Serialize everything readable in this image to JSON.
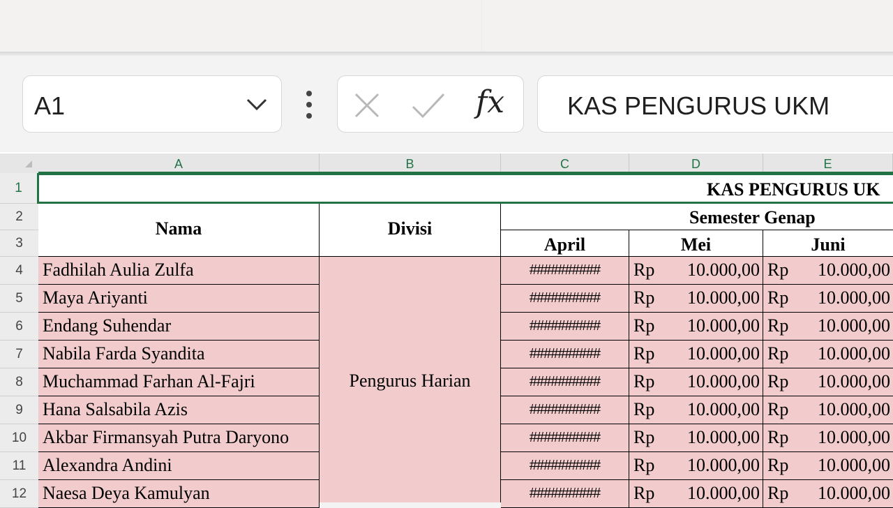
{
  "formula_bar": {
    "name_box": "A1",
    "formula": "KAS PENGURUS UKM"
  },
  "columns": [
    "A",
    "B",
    "C",
    "D",
    "E"
  ],
  "row_numbers": [
    "1",
    "2",
    "3",
    "4",
    "5",
    "6",
    "7",
    "8",
    "9",
    "10",
    "11",
    "12"
  ],
  "sheet": {
    "title": "KAS PENGURUS UK",
    "header_nama": "Nama",
    "header_divisi": "Divisi",
    "header_semester": "Semester Genap",
    "months": [
      "April",
      "Mei",
      "Juni"
    ],
    "divisi_value": "Pengurus Harian",
    "overflow": "##########",
    "currency": "Rp",
    "amount": "10.000,00",
    "members": [
      "Fadhilah Aulia Zulfa",
      "Maya Ariyanti",
      "Endang Suhendar",
      "Nabila Farda Syandita",
      "Muchammad Farhan Al-Fajri",
      "Hana Salsabila Azis",
      "Akbar Firmansyah Putra Daryono",
      "Alexandra Andini",
      "Naesa Deya Kamulyan"
    ]
  },
  "colors": {
    "accent": "#217346",
    "row_fill": "#f2cccc"
  }
}
